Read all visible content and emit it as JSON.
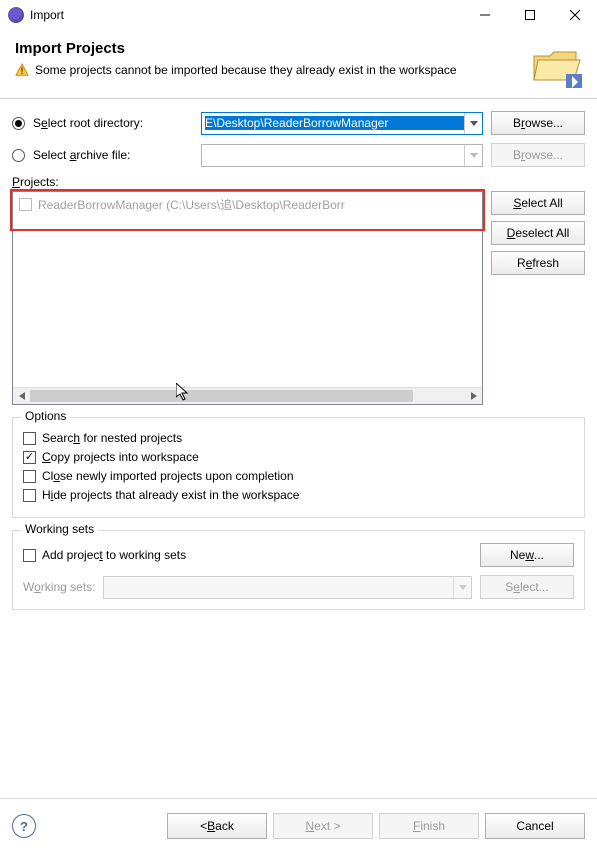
{
  "window": {
    "title": "Import"
  },
  "header": {
    "title": "Import Projects",
    "warning": "Some projects cannot be imported because they already exist in the workspace"
  },
  "source": {
    "root_label": "Select root directory:",
    "root_value": "E\\Desktop\\ReaderBorrowManager",
    "archive_label": "Select archive file:",
    "archive_value": "",
    "browse": "Browse..."
  },
  "projects": {
    "label": "Projects:",
    "item": "ReaderBorrowManager (C:\\Users\\追\\Desktop\\ReaderBorr",
    "select_all": "Select All",
    "deselect_all": "Deselect All",
    "refresh": "Refresh"
  },
  "options": {
    "legend": "Options",
    "search_nested": "Search for nested projects",
    "copy": "Copy projects into workspace",
    "close_imported": "Close newly imported projects upon completion",
    "hide_existing": "Hide projects that already exist in the workspace"
  },
  "working_sets": {
    "legend": "Working sets",
    "add_label": "Add project to working sets",
    "new": "New...",
    "ws_label": "Working sets:",
    "select": "Select..."
  },
  "footer": {
    "back": "< Back",
    "next": "Next >",
    "finish": "Finish",
    "cancel": "Cancel"
  }
}
